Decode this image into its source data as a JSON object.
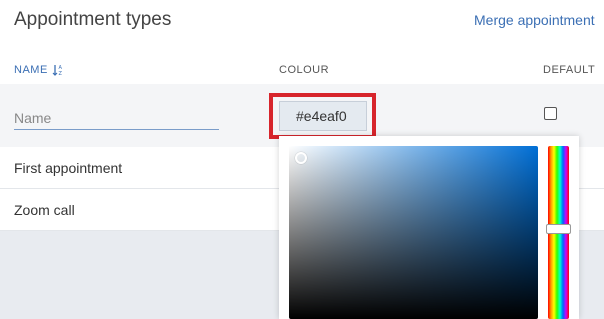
{
  "header": {
    "title": "Appointment types",
    "merge_link": "Merge appointment"
  },
  "table": {
    "columns": {
      "name": "NAME",
      "colour": "COLOUR",
      "default": "DEFAULT"
    },
    "new_row": {
      "name_placeholder": "Name",
      "colour_value": "#e4eaf0",
      "default_checked": false
    },
    "rows": [
      {
        "name": "First appointment"
      },
      {
        "name": "Zoom call"
      }
    ]
  },
  "colors": {
    "accent": "#3b6fb4",
    "highlight": "#d7252c",
    "picker_hue": "#006fd6"
  },
  "icons": {
    "sort": "sort-alpha-icon"
  }
}
